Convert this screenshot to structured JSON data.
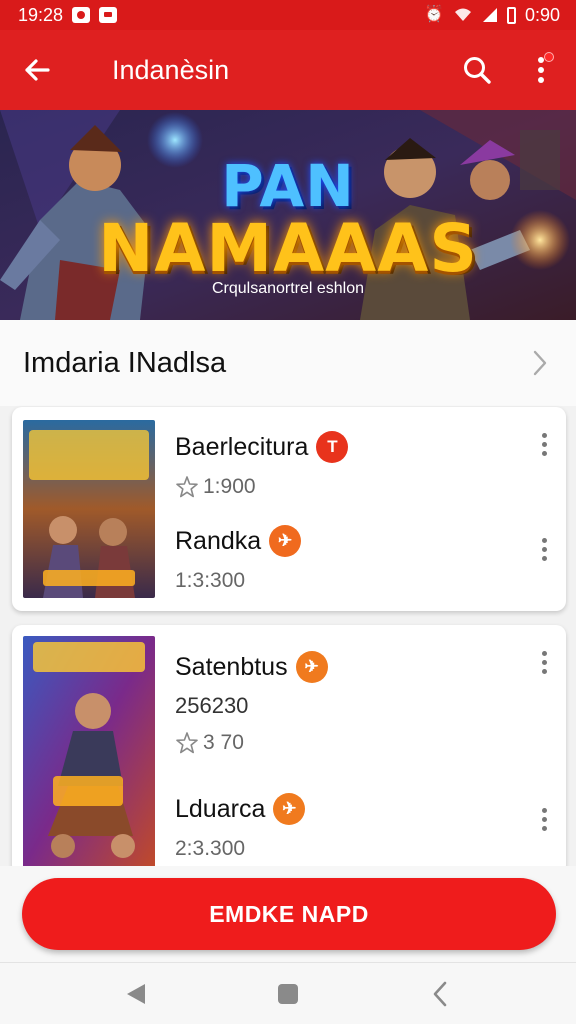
{
  "status_bar": {
    "time": "19:28",
    "right_text": "0:90",
    "icons": [
      "notification-icon",
      "mail-icon",
      "alarm-icon",
      "wifi-icon",
      "signal-icon",
      "battery-icon"
    ]
  },
  "app_bar": {
    "title": "Indanèsin",
    "icons": [
      "back-arrow-icon",
      "search-icon",
      "more-vertical-icon"
    ]
  },
  "banner": {
    "title_line1": "PAN",
    "title_line2": "NAMAAAS",
    "subtitle": "Crqulsanortrel eshlon"
  },
  "section": {
    "title": "Imdaria INadlsa",
    "icon": "chevron-right-icon"
  },
  "cards": [
    {
      "items": [
        {
          "name": "Baerlecitura",
          "badge": "T",
          "badge_color": "#e8331c",
          "meta": "1:900",
          "has_star": true
        },
        {
          "name": "Randka",
          "badge": "✈",
          "badge_color": "#f06a1e",
          "meta": "1:3:300",
          "has_star": false
        }
      ]
    },
    {
      "items": [
        {
          "name": "Satenbtus",
          "badge": "✈",
          "badge_color": "#f07a1e",
          "extra": "256230",
          "meta": "3 70",
          "has_star": true
        },
        {
          "name": "Lduarca",
          "badge": "✈",
          "badge_color": "#f07a1e",
          "meta": "2:3.300",
          "has_star": false
        }
      ]
    }
  ],
  "cta": {
    "label": "EMDKE NAPD"
  },
  "colors": {
    "primary": "#df2020",
    "status": "#d91a1a",
    "cta": "#ef1c1c"
  },
  "nav": {
    "icons": [
      "nav-back-icon",
      "nav-home-icon",
      "nav-recent-icon"
    ]
  }
}
